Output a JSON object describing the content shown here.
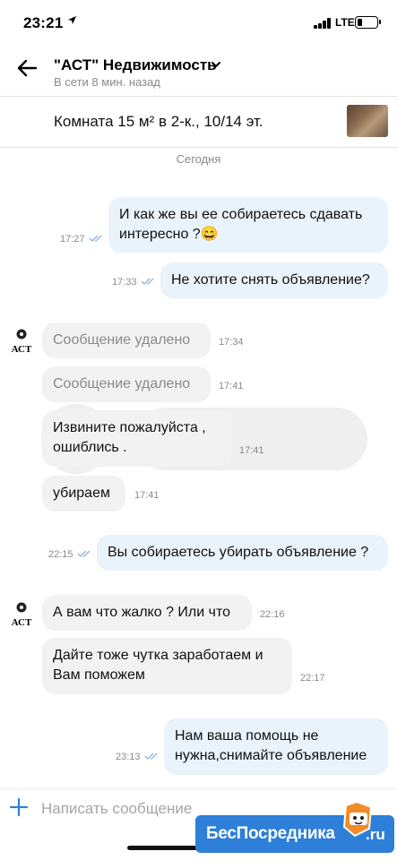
{
  "status_bar": {
    "time": "23:21",
    "network": "LTE",
    "battery_level": 0.2
  },
  "header": {
    "title": "\"АСТ\" Недвижимость",
    "subtitle": "В сети 8 мин. назад"
  },
  "listing": {
    "title": "Комната 15 м² в 2-к., 10/14 эт."
  },
  "date_separator": "Сегодня",
  "avatar_text": "АСТ",
  "messages": [
    {
      "dir": "out",
      "line1": "И как же вы ее собираетесь сдавать",
      "line2": "интересно ?😄",
      "time": "17:27"
    },
    {
      "dir": "out",
      "text": "Не хотите снять объявление?",
      "time": "17:33"
    },
    {
      "dir": "in",
      "text": "Сообщение удалено",
      "time": "17:34"
    },
    {
      "dir": "in",
      "text": "Сообщение удалено",
      "time": "17:41"
    },
    {
      "dir": "in",
      "line1": "Извините пожалуйста ,",
      "line2": "ошиблись .",
      "time": "17:41"
    },
    {
      "dir": "in",
      "text": "убираем",
      "time": "17:41"
    },
    {
      "dir": "out",
      "text": "Вы собираетесь убирать объявление ?",
      "time": "22:15"
    },
    {
      "dir": "in",
      "text": "А вам что жалко ? Или что",
      "time": "22:16"
    },
    {
      "dir": "in",
      "line1": "Дайте тоже чутка заработаем и",
      "line2": "Вам поможем",
      "time": "22:17"
    },
    {
      "dir": "out",
      "line1": "Нам ваша помощь не",
      "line2": "нужна,снимайте объявление",
      "time": "23:13"
    }
  ],
  "composer": {
    "placeholder": "Написать сообщение"
  },
  "badge": {
    "text": "БесПосредника",
    "suffix": ".ru"
  },
  "colors": {
    "outgoing_bubble": "#e8f3fc",
    "incoming_bubble": "#f2f2f2",
    "accent": "#2d7fd8",
    "read_ticks": "#8fb3d9"
  }
}
